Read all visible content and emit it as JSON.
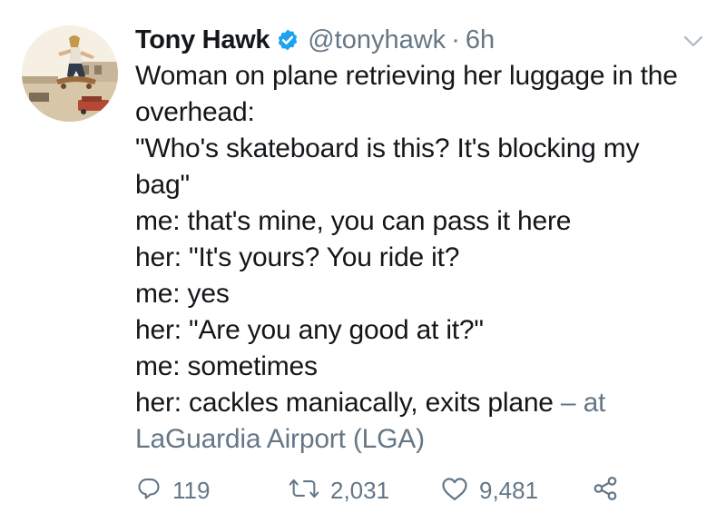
{
  "tweet": {
    "author_name": "Tony Hawk",
    "handle": "@tonyhawk",
    "separator": "·",
    "time": "6h",
    "text_lines": [
      "Woman on plane retrieving her luggage in the",
      "overhead:",
      "\"Who's skateboard is this? It's blocking my",
      "bag\"",
      "me: that's mine, you can pass it here",
      "her: \"It's yours? You ride it?",
      "me: yes",
      "her: \"Are you any good at it?\"",
      "me: sometimes",
      "her: cackles maniacally, exits plane"
    ],
    "location_dash": " – ",
    "location_prefix": "at",
    "location_line": "LaGuardia Airport (LGA)",
    "actions": {
      "replies": "119",
      "retweets": "2,031",
      "likes": "9,481"
    }
  },
  "icons": {
    "verified": "verified-badge-icon",
    "menu": "chevron-down-icon",
    "reply": "reply-icon",
    "retweet": "retweet-icon",
    "like": "heart-icon",
    "share": "share-icon"
  },
  "colors": {
    "text": "#14171a",
    "muted": "#657786",
    "verified": "#1da1f2"
  }
}
